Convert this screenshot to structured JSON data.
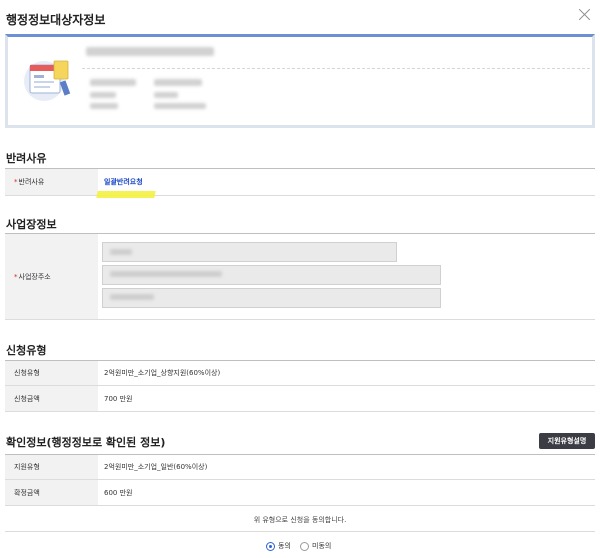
{
  "modal": {
    "title": "행정정보대상자정보",
    "close_icon": "close-icon"
  },
  "return_reason": {
    "title": "반려사유",
    "label": "반려사유",
    "value": "일괄반려요청",
    "link_color": "#1a47c4",
    "highlight_color": "#f4f140"
  },
  "business_info": {
    "title": "사업장정보",
    "address_label": "사업장주소"
  },
  "application_type": {
    "title": "신청유형",
    "rows": [
      {
        "label": "신청유형",
        "value": "2억원미만_소기업_상향지원(60%이상)"
      },
      {
        "label": "신청금액",
        "value": "700 만원"
      }
    ]
  },
  "confirmed_info": {
    "title": "확인정보(행정정보로 확인된 정보)",
    "button_label": "지원유형설명",
    "rows": [
      {
        "label": "지원유형",
        "value": "2억원미만_소기업_일반(60%이상)"
      },
      {
        "label": "확정금액",
        "value": "600 만원"
      }
    ]
  },
  "consent": {
    "text": "위 유형으로 신청을 동의합니다.",
    "options": [
      {
        "label": "동의",
        "selected": true
      },
      {
        "label": "미동의",
        "selected": false
      }
    ],
    "selected_color": "#2c63d6"
  },
  "colors": {
    "accent": "#6d8fd6",
    "required": "#e02020",
    "header_bg": "#f2f2f2"
  }
}
